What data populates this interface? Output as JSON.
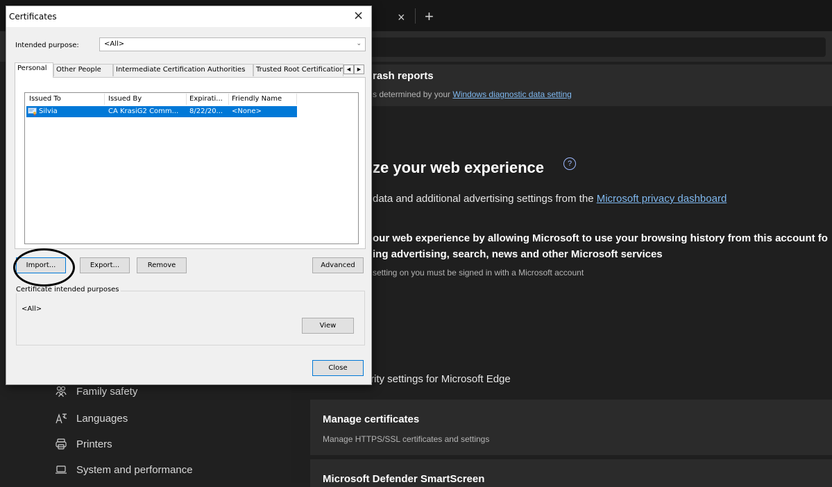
{
  "browser": {
    "tab_close_glyph": "×",
    "tab_new_glyph": "+"
  },
  "settings": {
    "crash": {
      "title": "rash reports",
      "desc_prefix": "s determined by your ",
      "desc_link": "Windows diagnostic data setting"
    },
    "personalize": {
      "heading": "ze your web experience",
      "help_glyph": "?",
      "desc_prefix": "data and additional advertising settings from the ",
      "desc_link": "Microsoft privacy dashboard"
    },
    "improve": {
      "line1": "our web experience by allowing Microsoft to use your browsing history from this account fo",
      "line2": "ing advertising, search, news and other Microsoft services",
      "note": "setting on you must be signed in with a Microsoft account"
    },
    "security_partial": "rity settings for Microsoft Edge",
    "manage_certs": {
      "title": "Manage certificates",
      "desc": "Manage HTTPS/SSL certificates and settings"
    },
    "smartscreen_title": "Microsoft Defender SmartScreen"
  },
  "sidebar": {
    "items": [
      {
        "label": "Family safety",
        "icon": "family-icon"
      },
      {
        "label": "Languages",
        "icon": "languages-icon"
      },
      {
        "label": "Printers",
        "icon": "printer-icon"
      },
      {
        "label": "System and performance",
        "icon": "laptop-icon"
      }
    ]
  },
  "dialog": {
    "title": "Certificates",
    "close_glyph": "×",
    "intended_purpose_label": "Intended purpose:",
    "intended_purpose_value": "<All>",
    "tabs": [
      "Personal",
      "Other People",
      "Intermediate Certification Authorities",
      "Trusted Root Certification"
    ],
    "columns": [
      "Issued To",
      "Issued By",
      "Expirati...",
      "Friendly Name"
    ],
    "rows": [
      {
        "issued_to": "Silvia",
        "issued_by": "CA KrasiG2 Comm...",
        "expiration": "8/22/20...",
        "friendly_name": "<None>"
      }
    ],
    "buttons": {
      "import": "Import...",
      "export": "Export...",
      "remove": "Remove",
      "advanced": "Advanced",
      "view": "View",
      "close": "Close"
    },
    "purposes_label": "Certificate intended purposes",
    "purposes_value": "<All>"
  }
}
